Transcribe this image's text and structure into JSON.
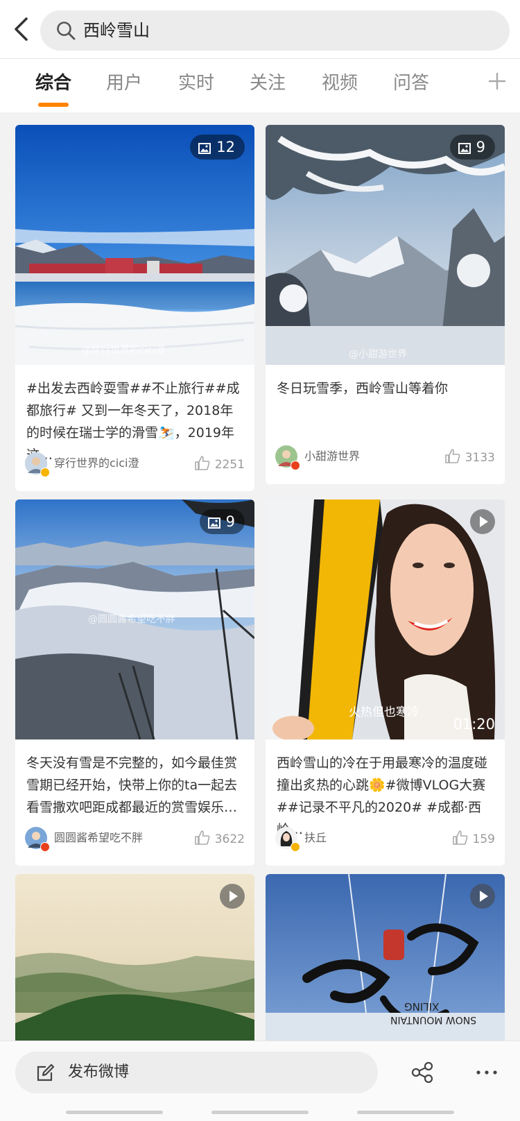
{
  "search": {
    "query": "西岭雪山"
  },
  "tabs": [
    {
      "label": "综合"
    },
    {
      "label": "用户"
    },
    {
      "label": "实时"
    },
    {
      "label": "关注"
    },
    {
      "label": "视频"
    },
    {
      "label": "问答"
    }
  ],
  "cards": [
    {
      "badge": "12",
      "watermark": "@穿行世界的cici澄",
      "text": "#出发去西岭耍雪##不止旅行##成都旅行# 又到一年冬天了，2018年的时候在瑞士学的滑雪⛷️，2019年这…",
      "author": "穿行世界的cici澄",
      "likes": "2251"
    },
    {
      "badge": "9",
      "watermark": "@小甜游世界",
      "text": "冬日玩雪季，西岭雪山等着你",
      "author": "小甜游世界",
      "likes": "3133"
    },
    {
      "badge": "9",
      "watermark": "@圆圆酱希望吃不胖",
      "text": "冬天没有雪是不完整的，如今最佳赏雪期已经开始，快带上你的ta一起去看雪撒欢吧距成都最近的赏雪娱乐…",
      "author": "圆圆酱希望吃不胖",
      "likes": "3622"
    },
    {
      "duration": "01:20",
      "caption": "火热但也寒冷",
      "text": "西岭雪山的冷在于用最寒冷的温度碰撞出炙热的心跳🌼#微博VLOG大赛##记录不平凡的2020# #成都·西岭…",
      "author": "扶丘",
      "likes": "159"
    },
    {},
    {
      "sign_line1": "XILING",
      "sign_line2": "SNOW MOUNTAIN"
    }
  ],
  "bottom": {
    "compose_label": "发布微博"
  },
  "colors": {
    "accent": "#ff8200",
    "verified_gold": "#f5b400",
    "verified_red": "#e8401c"
  }
}
